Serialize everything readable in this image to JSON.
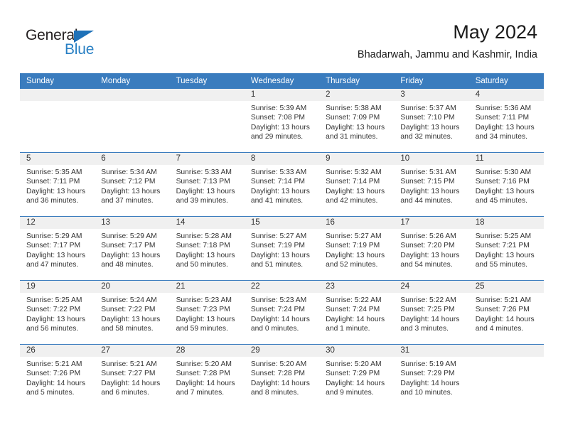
{
  "logo": {
    "word_one": "General",
    "word_two": "Blue",
    "triangle_color": "#1e71b8",
    "blue_color": "#2980c4"
  },
  "header": {
    "title": "May 2024",
    "subtitle": "Bhadarwah, Jammu and Kashmir, India"
  },
  "calendar": {
    "header_color": "#3A7CBE",
    "day_band_color": "#f0f0f0",
    "weekdays": [
      "Sunday",
      "Monday",
      "Tuesday",
      "Wednesday",
      "Thursday",
      "Friday",
      "Saturday"
    ],
    "weeks": [
      [
        {
          "day": "",
          "empty": true,
          "sunrise": "",
          "sunset": "",
          "daylight_line1": "",
          "daylight_line2": ""
        },
        {
          "day": "",
          "empty": true,
          "sunrise": "",
          "sunset": "",
          "daylight_line1": "",
          "daylight_line2": ""
        },
        {
          "day": "",
          "empty": true,
          "sunrise": "",
          "sunset": "",
          "daylight_line1": "",
          "daylight_line2": ""
        },
        {
          "day": "1",
          "empty": false,
          "sunrise": "Sunrise: 5:39 AM",
          "sunset": "Sunset: 7:08 PM",
          "daylight_line1": "Daylight: 13 hours",
          "daylight_line2": "and 29 minutes."
        },
        {
          "day": "2",
          "empty": false,
          "sunrise": "Sunrise: 5:38 AM",
          "sunset": "Sunset: 7:09 PM",
          "daylight_line1": "Daylight: 13 hours",
          "daylight_line2": "and 31 minutes."
        },
        {
          "day": "3",
          "empty": false,
          "sunrise": "Sunrise: 5:37 AM",
          "sunset": "Sunset: 7:10 PM",
          "daylight_line1": "Daylight: 13 hours",
          "daylight_line2": "and 32 minutes."
        },
        {
          "day": "4",
          "empty": false,
          "sunrise": "Sunrise: 5:36 AM",
          "sunset": "Sunset: 7:11 PM",
          "daylight_line1": "Daylight: 13 hours",
          "daylight_line2": "and 34 minutes."
        }
      ],
      [
        {
          "day": "5",
          "empty": false,
          "sunrise": "Sunrise: 5:35 AM",
          "sunset": "Sunset: 7:11 PM",
          "daylight_line1": "Daylight: 13 hours",
          "daylight_line2": "and 36 minutes."
        },
        {
          "day": "6",
          "empty": false,
          "sunrise": "Sunrise: 5:34 AM",
          "sunset": "Sunset: 7:12 PM",
          "daylight_line1": "Daylight: 13 hours",
          "daylight_line2": "and 37 minutes."
        },
        {
          "day": "7",
          "empty": false,
          "sunrise": "Sunrise: 5:33 AM",
          "sunset": "Sunset: 7:13 PM",
          "daylight_line1": "Daylight: 13 hours",
          "daylight_line2": "and 39 minutes."
        },
        {
          "day": "8",
          "empty": false,
          "sunrise": "Sunrise: 5:33 AM",
          "sunset": "Sunset: 7:14 PM",
          "daylight_line1": "Daylight: 13 hours",
          "daylight_line2": "and 41 minutes."
        },
        {
          "day": "9",
          "empty": false,
          "sunrise": "Sunrise: 5:32 AM",
          "sunset": "Sunset: 7:14 PM",
          "daylight_line1": "Daylight: 13 hours",
          "daylight_line2": "and 42 minutes."
        },
        {
          "day": "10",
          "empty": false,
          "sunrise": "Sunrise: 5:31 AM",
          "sunset": "Sunset: 7:15 PM",
          "daylight_line1": "Daylight: 13 hours",
          "daylight_line2": "and 44 minutes."
        },
        {
          "day": "11",
          "empty": false,
          "sunrise": "Sunrise: 5:30 AM",
          "sunset": "Sunset: 7:16 PM",
          "daylight_line1": "Daylight: 13 hours",
          "daylight_line2": "and 45 minutes."
        }
      ],
      [
        {
          "day": "12",
          "empty": false,
          "sunrise": "Sunrise: 5:29 AM",
          "sunset": "Sunset: 7:17 PM",
          "daylight_line1": "Daylight: 13 hours",
          "daylight_line2": "and 47 minutes."
        },
        {
          "day": "13",
          "empty": false,
          "sunrise": "Sunrise: 5:29 AM",
          "sunset": "Sunset: 7:17 PM",
          "daylight_line1": "Daylight: 13 hours",
          "daylight_line2": "and 48 minutes."
        },
        {
          "day": "14",
          "empty": false,
          "sunrise": "Sunrise: 5:28 AM",
          "sunset": "Sunset: 7:18 PM",
          "daylight_line1": "Daylight: 13 hours",
          "daylight_line2": "and 50 minutes."
        },
        {
          "day": "15",
          "empty": false,
          "sunrise": "Sunrise: 5:27 AM",
          "sunset": "Sunset: 7:19 PM",
          "daylight_line1": "Daylight: 13 hours",
          "daylight_line2": "and 51 minutes."
        },
        {
          "day": "16",
          "empty": false,
          "sunrise": "Sunrise: 5:27 AM",
          "sunset": "Sunset: 7:19 PM",
          "daylight_line1": "Daylight: 13 hours",
          "daylight_line2": "and 52 minutes."
        },
        {
          "day": "17",
          "empty": false,
          "sunrise": "Sunrise: 5:26 AM",
          "sunset": "Sunset: 7:20 PM",
          "daylight_line1": "Daylight: 13 hours",
          "daylight_line2": "and 54 minutes."
        },
        {
          "day": "18",
          "empty": false,
          "sunrise": "Sunrise: 5:25 AM",
          "sunset": "Sunset: 7:21 PM",
          "daylight_line1": "Daylight: 13 hours",
          "daylight_line2": "and 55 minutes."
        }
      ],
      [
        {
          "day": "19",
          "empty": false,
          "sunrise": "Sunrise: 5:25 AM",
          "sunset": "Sunset: 7:22 PM",
          "daylight_line1": "Daylight: 13 hours",
          "daylight_line2": "and 56 minutes."
        },
        {
          "day": "20",
          "empty": false,
          "sunrise": "Sunrise: 5:24 AM",
          "sunset": "Sunset: 7:22 PM",
          "daylight_line1": "Daylight: 13 hours",
          "daylight_line2": "and 58 minutes."
        },
        {
          "day": "21",
          "empty": false,
          "sunrise": "Sunrise: 5:23 AM",
          "sunset": "Sunset: 7:23 PM",
          "daylight_line1": "Daylight: 13 hours",
          "daylight_line2": "and 59 minutes."
        },
        {
          "day": "22",
          "empty": false,
          "sunrise": "Sunrise: 5:23 AM",
          "sunset": "Sunset: 7:24 PM",
          "daylight_line1": "Daylight: 14 hours",
          "daylight_line2": "and 0 minutes."
        },
        {
          "day": "23",
          "empty": false,
          "sunrise": "Sunrise: 5:22 AM",
          "sunset": "Sunset: 7:24 PM",
          "daylight_line1": "Daylight: 14 hours",
          "daylight_line2": "and 1 minute."
        },
        {
          "day": "24",
          "empty": false,
          "sunrise": "Sunrise: 5:22 AM",
          "sunset": "Sunset: 7:25 PM",
          "daylight_line1": "Daylight: 14 hours",
          "daylight_line2": "and 3 minutes."
        },
        {
          "day": "25",
          "empty": false,
          "sunrise": "Sunrise: 5:21 AM",
          "sunset": "Sunset: 7:26 PM",
          "daylight_line1": "Daylight: 14 hours",
          "daylight_line2": "and 4 minutes."
        }
      ],
      [
        {
          "day": "26",
          "empty": false,
          "sunrise": "Sunrise: 5:21 AM",
          "sunset": "Sunset: 7:26 PM",
          "daylight_line1": "Daylight: 14 hours",
          "daylight_line2": "and 5 minutes."
        },
        {
          "day": "27",
          "empty": false,
          "sunrise": "Sunrise: 5:21 AM",
          "sunset": "Sunset: 7:27 PM",
          "daylight_line1": "Daylight: 14 hours",
          "daylight_line2": "and 6 minutes."
        },
        {
          "day": "28",
          "empty": false,
          "sunrise": "Sunrise: 5:20 AM",
          "sunset": "Sunset: 7:28 PM",
          "daylight_line1": "Daylight: 14 hours",
          "daylight_line2": "and 7 minutes."
        },
        {
          "day": "29",
          "empty": false,
          "sunrise": "Sunrise: 5:20 AM",
          "sunset": "Sunset: 7:28 PM",
          "daylight_line1": "Daylight: 14 hours",
          "daylight_line2": "and 8 minutes."
        },
        {
          "day": "30",
          "empty": false,
          "sunrise": "Sunrise: 5:20 AM",
          "sunset": "Sunset: 7:29 PM",
          "daylight_line1": "Daylight: 14 hours",
          "daylight_line2": "and 9 minutes."
        },
        {
          "day": "31",
          "empty": false,
          "sunrise": "Sunrise: 5:19 AM",
          "sunset": "Sunset: 7:29 PM",
          "daylight_line1": "Daylight: 14 hours",
          "daylight_line2": "and 10 minutes."
        },
        {
          "day": "",
          "empty": true,
          "sunrise": "",
          "sunset": "",
          "daylight_line1": "",
          "daylight_line2": ""
        }
      ]
    ]
  }
}
